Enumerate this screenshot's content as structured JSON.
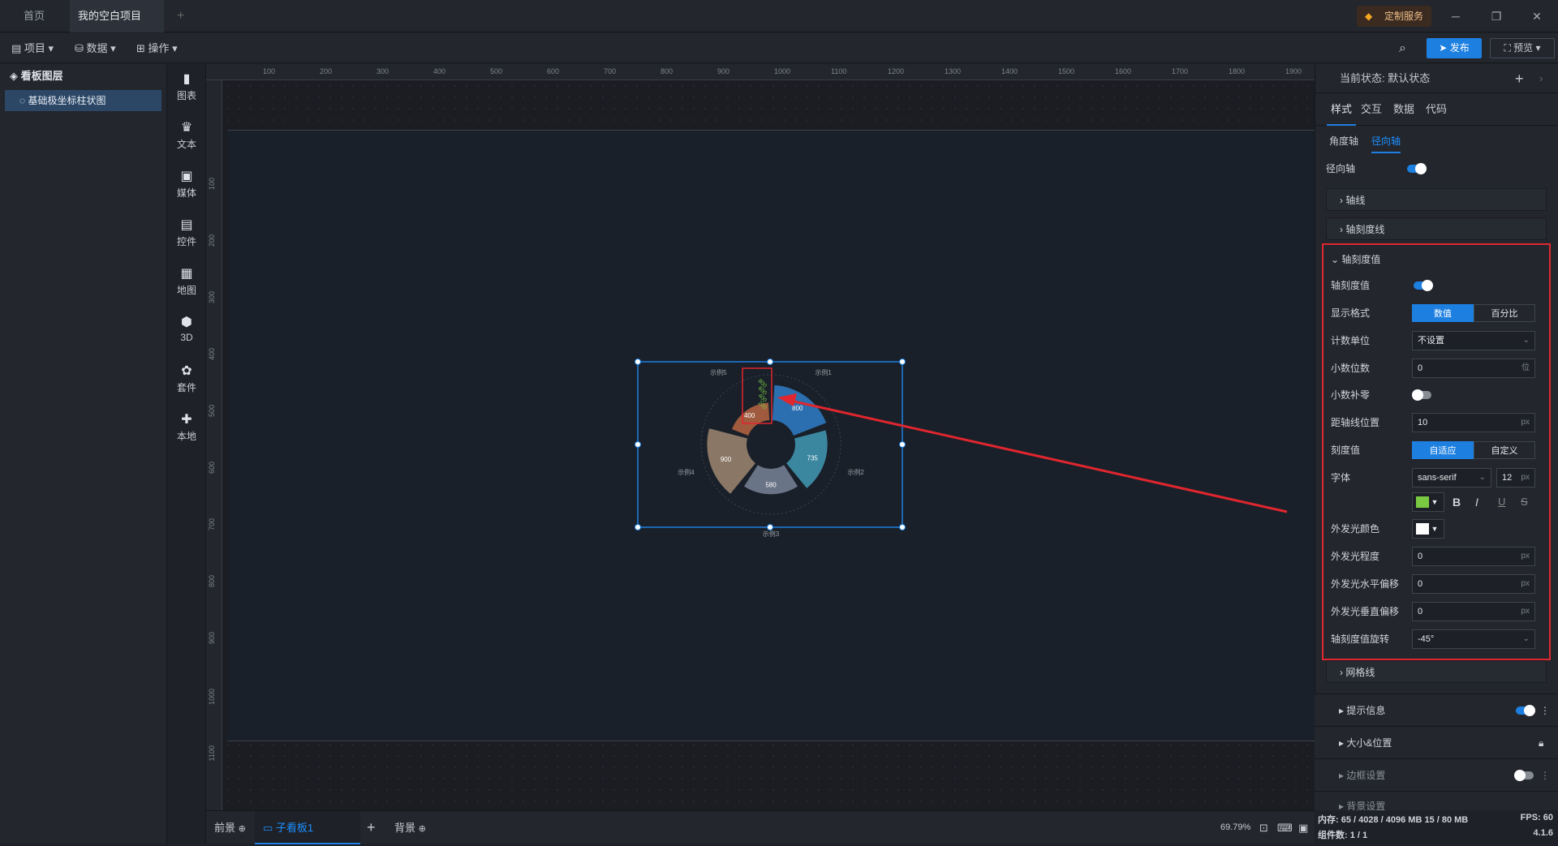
{
  "tabs": {
    "home": "首页",
    "project": "我的空白项目",
    "add": "+"
  },
  "service": "定制服务",
  "toolbar": {
    "project": "项目",
    "data": "数据",
    "operate": "操作",
    "publish": "发布",
    "preview": "预览"
  },
  "layers": {
    "title": "看板图层",
    "item": "基础极坐标柱状图"
  },
  "components": [
    {
      "label": "图表",
      "icon": "chart-icon"
    },
    {
      "label": "文本",
      "icon": "text-icon"
    },
    {
      "label": "媒体",
      "icon": "media-icon"
    },
    {
      "label": "控件",
      "icon": "control-icon"
    },
    {
      "label": "地图",
      "icon": "map-icon"
    },
    {
      "label": "3D",
      "icon": "cube-icon"
    },
    {
      "label": "套件",
      "icon": "kit-icon"
    },
    {
      "label": "本地",
      "icon": "puzzle-icon"
    }
  ],
  "ruler": {
    "h_ticks": [
      "100",
      "200",
      "300",
      "400",
      "500",
      "600",
      "700",
      "800",
      "900",
      "1000",
      "1100",
      "1200",
      "1300",
      "1400",
      "1500",
      "1600",
      "1700",
      "1800",
      "1900"
    ],
    "v_ticks": [
      "100",
      "200",
      "300",
      "400",
      "500",
      "600",
      "700",
      "800",
      "900",
      "1000",
      "1100"
    ]
  },
  "chart": {
    "categories": [
      "示例1",
      "示例2",
      "示例3",
      "示例4",
      "示例5"
    ],
    "values": [
      800,
      735,
      580,
      900,
      400
    ],
    "colors": [
      "#2b6fb0",
      "#3b87a0",
      "#6a7487",
      "#8a7766",
      "#a05a3e"
    ]
  },
  "bottom": {
    "foreground": "前景",
    "subboard": "子看板1",
    "add": "+",
    "background": "背景",
    "zoom": "69.79%"
  },
  "panel": {
    "state_label": "当前状态: 默认状态",
    "tabs": [
      "样式",
      "交互",
      "数据",
      "代码"
    ],
    "subtabs": [
      "角度轴",
      "径向轴"
    ],
    "radial_axis": "径向轴",
    "axis_line": "轴线",
    "axis_tick": "轴刻度线",
    "axis_label_section": "轴刻度值",
    "axis_label": "轴刻度值",
    "display_format": "显示格式",
    "fmt_value": "数值",
    "fmt_percent": "百分比",
    "count_unit": "计数单位",
    "count_unit_value": "不设置",
    "decimals": "小数位数",
    "decimals_value": "0",
    "decimals_unit": "位",
    "zero_pad": "小数补零",
    "distance": "距轴线位置",
    "distance_value": "10",
    "px": "px",
    "tick_value": "刻度值",
    "adaptive": "自适应",
    "custom": "自定义",
    "font": "字体",
    "font_family": "sans-serif",
    "font_size": "12",
    "bold": "B",
    "italic": "I",
    "underline": "U",
    "strike": "S",
    "glow_color": "外发光颜色",
    "glow_level": "外发光程度",
    "glow_level_value": "0",
    "glow_h": "外发光水平偏移",
    "glow_h_value": "0",
    "glow_v": "外发光垂直偏移",
    "glow_v_value": "0",
    "rotate": "轴刻度值旋转",
    "rotate_value": "-45°",
    "grid": "网格线",
    "tooltip": "提示信息",
    "size_pos": "大小&位置",
    "border": "边框设置",
    "bg_setting": "背景设置"
  },
  "status": {
    "memory": "内存: 65 / 4028 / 4096 MB  15 / 80 MB",
    "fps": "FPS: 60",
    "components": "组件数: 1 / 1",
    "version": "4.1.6"
  },
  "colors": {
    "accent": "#1d7fe0",
    "highlight": "#e0262e",
    "font_color": "#7ac943"
  }
}
